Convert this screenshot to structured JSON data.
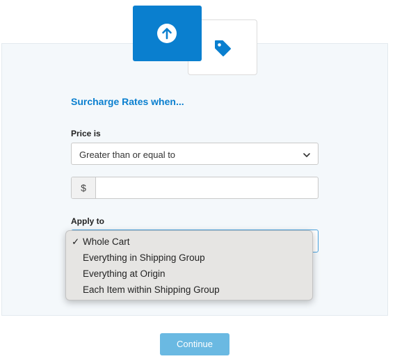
{
  "icons": {
    "upload": "arrow-up-circle-icon",
    "tag": "tag-icon",
    "chevron": "chevron-down-icon"
  },
  "colors": {
    "accent": "#0a7fcf",
    "button": "#6ab9e2",
    "panel": "#f4f8fb"
  },
  "form": {
    "heading": "Surcharge Rates when...",
    "price_label": "Price is",
    "price_select_value": "Greater than or equal to",
    "currency_symbol": "$",
    "amount_value": "",
    "apply_label": "Apply to"
  },
  "dropdown": {
    "selected_mark": "✓",
    "options": [
      "Whole Cart",
      "Everything in Shipping Group",
      "Everything at Origin",
      "Each Item within Shipping Group"
    ]
  },
  "footer": {
    "continue_label": "Continue"
  }
}
